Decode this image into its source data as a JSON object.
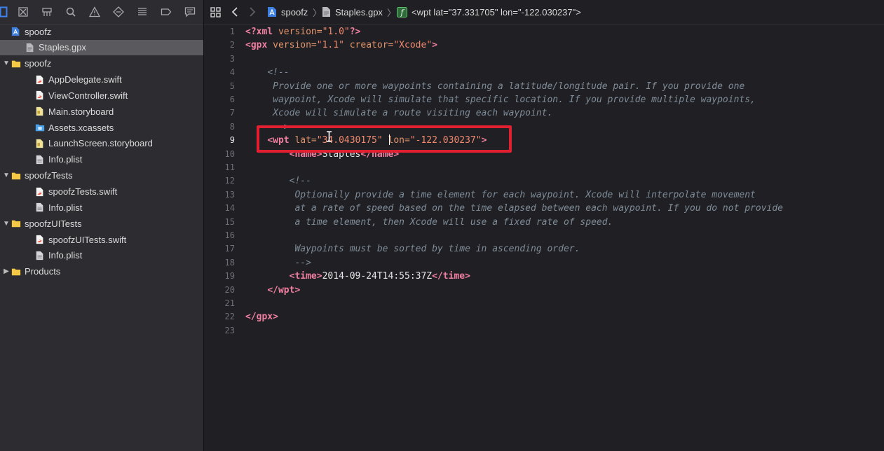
{
  "navigator": {
    "toolbar_icons": [
      "folder-icon",
      "source-control-icon",
      "symbol-navigator-icon",
      "find-icon",
      "issue-icon",
      "test-icon",
      "debug-icon",
      "breakpoint-icon",
      "report-icon"
    ],
    "tree": [
      {
        "label": "spoofz",
        "kind": "project",
        "indent": 0,
        "disclosure": ""
      },
      {
        "label": "Staples.gpx",
        "kind": "gpx",
        "indent": 1,
        "disclosure": "",
        "selected": true
      },
      {
        "label": "spoofz",
        "kind": "folder",
        "indent": 0,
        "disclosure": "▼"
      },
      {
        "label": "AppDelegate.swift",
        "kind": "swift",
        "indent": 2,
        "disclosure": ""
      },
      {
        "label": "ViewController.swift",
        "kind": "swift",
        "indent": 2,
        "disclosure": ""
      },
      {
        "label": "Main.storyboard",
        "kind": "storyboard",
        "indent": 2,
        "disclosure": ""
      },
      {
        "label": "Assets.xcassets",
        "kind": "assets",
        "indent": 2,
        "disclosure": ""
      },
      {
        "label": "LaunchScreen.storyboard",
        "kind": "storyboard",
        "indent": 2,
        "disclosure": ""
      },
      {
        "label": "Info.plist",
        "kind": "plist",
        "indent": 2,
        "disclosure": ""
      },
      {
        "label": "spoofzTests",
        "kind": "folder",
        "indent": 0,
        "disclosure": "▼"
      },
      {
        "label": "spoofzTests.swift",
        "kind": "swift",
        "indent": 2,
        "disclosure": ""
      },
      {
        "label": "Info.plist",
        "kind": "plist",
        "indent": 2,
        "disclosure": ""
      },
      {
        "label": "spoofzUITests",
        "kind": "folder",
        "indent": 0,
        "disclosure": "▼"
      },
      {
        "label": "spoofzUITests.swift",
        "kind": "swift",
        "indent": 2,
        "disclosure": ""
      },
      {
        "label": "Info.plist",
        "kind": "plist",
        "indent": 2,
        "disclosure": ""
      },
      {
        "label": "Products",
        "kind": "folder",
        "indent": 0,
        "disclosure": "▶"
      }
    ]
  },
  "jumpbar": {
    "project": "spoofz",
    "file": "Staples.gpx",
    "symbol": "<wpt lat=\"37.331705\" lon=\"-122.030237\">"
  },
  "editor": {
    "current_line": 9,
    "lines": [
      [
        [
          "tag",
          "<?xml"
        ],
        [
          "text",
          " "
        ],
        [
          "attr",
          "version="
        ],
        [
          "str",
          "\"1.0\""
        ],
        [
          "tag",
          "?>"
        ]
      ],
      [
        [
          "tag",
          "<gpx"
        ],
        [
          "text",
          " "
        ],
        [
          "attr",
          "version="
        ],
        [
          "str",
          "\"1.1\""
        ],
        [
          "text",
          " "
        ],
        [
          "attr",
          "creator="
        ],
        [
          "str",
          "\"Xcode\""
        ],
        [
          "tag",
          ">"
        ]
      ],
      [],
      [
        [
          "text",
          "    "
        ],
        [
          "comment",
          "<!--"
        ]
      ],
      [
        [
          "comment",
          "     Provide one or more waypoints containing a latitude/longitude pair. If you provide one"
        ]
      ],
      [
        [
          "comment",
          "     waypoint, Xcode will simulate that specific location. If you provide multiple waypoints,"
        ]
      ],
      [
        [
          "comment",
          "     Xcode will simulate a route visiting each waypoint."
        ]
      ],
      [
        [
          "comment",
          "     -->"
        ]
      ],
      [
        [
          "text",
          "    "
        ],
        [
          "tag",
          "<wpt"
        ],
        [
          "text",
          " "
        ],
        [
          "attr",
          "lat="
        ],
        [
          "str",
          "\"34.0430175\""
        ],
        [
          "text",
          " "
        ],
        [
          "attr",
          "lon="
        ],
        [
          "str",
          "\"-122.030237\""
        ],
        [
          "tag",
          ">"
        ]
      ],
      [
        [
          "text",
          "        "
        ],
        [
          "tag",
          "<name>"
        ],
        [
          "text",
          "Staples"
        ],
        [
          "tag",
          "</name>"
        ]
      ],
      [],
      [
        [
          "text",
          "        "
        ],
        [
          "comment",
          "<!--"
        ]
      ],
      [
        [
          "comment",
          "         Optionally provide a time element for each waypoint. Xcode will interpolate movement"
        ]
      ],
      [
        [
          "comment",
          "         at a rate of speed based on the time elapsed between each waypoint. If you do not provide"
        ]
      ],
      [
        [
          "comment",
          "         a time element, then Xcode will use a fixed rate of speed."
        ]
      ],
      [],
      [
        [
          "comment",
          "         Waypoints must be sorted by time in ascending order."
        ]
      ],
      [
        [
          "comment",
          "         -->"
        ]
      ],
      [
        [
          "text",
          "        "
        ],
        [
          "tag",
          "<time>"
        ],
        [
          "text",
          "2014-09-24T14:55:37Z"
        ],
        [
          "tag",
          "</time>"
        ]
      ],
      [
        [
          "text",
          "    "
        ],
        [
          "tag",
          "</wpt>"
        ]
      ],
      [],
      [
        [
          "tag",
          "</gpx>"
        ]
      ],
      []
    ]
  },
  "colors": {
    "highlight_box": "#e02030",
    "selection": "#5a595e",
    "folder": "#f5c944",
    "swift": "#f2533a"
  }
}
